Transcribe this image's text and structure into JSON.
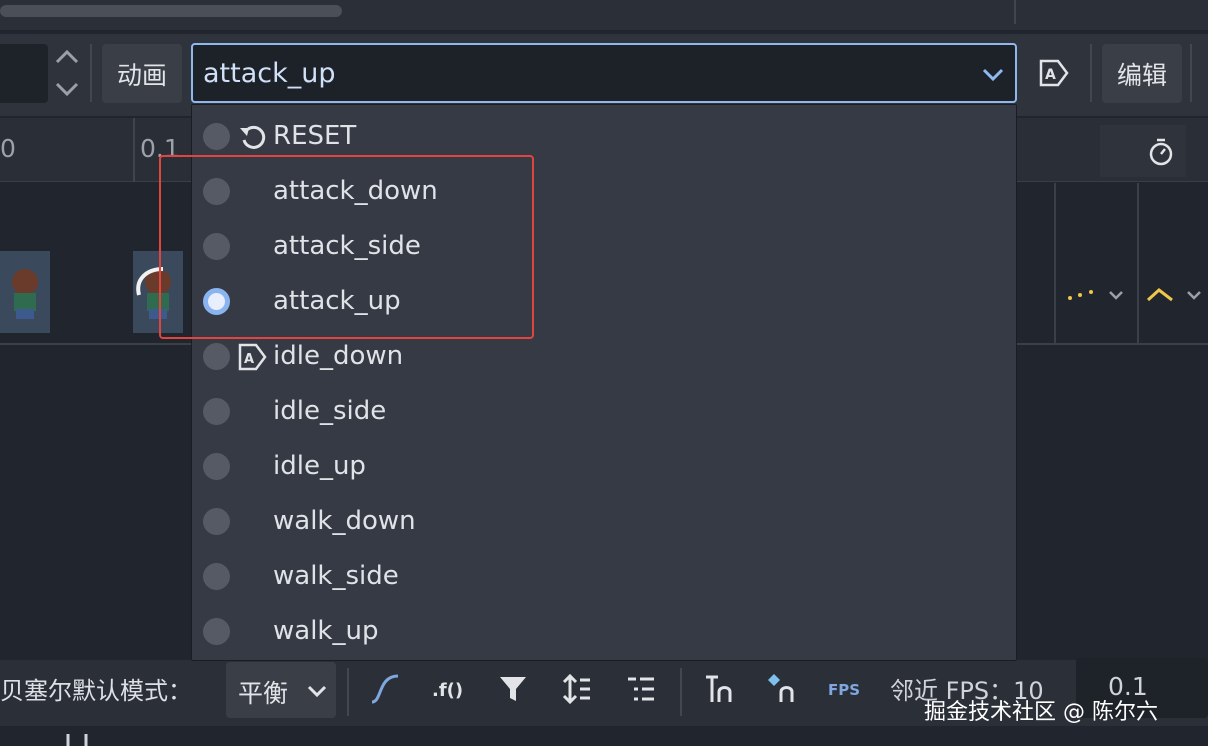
{
  "toolbar": {
    "animation_label": "动画",
    "edit_label": "编辑",
    "selected_animation": "attack_up"
  },
  "ruler": {
    "tick0": "0",
    "tick1": "0.1"
  },
  "dropdown": {
    "options": [
      {
        "label": "RESET",
        "selected": false,
        "icon": "reset-icon"
      },
      {
        "label": "attack_down",
        "selected": false
      },
      {
        "label": "attack_side",
        "selected": false
      },
      {
        "label": "attack_up",
        "selected": true
      },
      {
        "label": "idle_down",
        "selected": false,
        "icon": "autoplay-icon"
      },
      {
        "label": "idle_side",
        "selected": false
      },
      {
        "label": "idle_up",
        "selected": false
      },
      {
        "label": "walk_down",
        "selected": false
      },
      {
        "label": "walk_side",
        "selected": false
      },
      {
        "label": "walk_up",
        "selected": false
      }
    ]
  },
  "bottom": {
    "bezier_label": "贝塞尔默认模式：",
    "bezier_mode": "平衡",
    "fps_icon_text": "FPS",
    "snap_label": "邻近 FPS：10",
    "snap_value": "0.1"
  },
  "watermark": "掘金技术社区 @ 陈尔六",
  "colors": {
    "accent": "#8fb8ef",
    "highlight_box": "#e24440",
    "easing_yellow": "#f0c64a"
  }
}
